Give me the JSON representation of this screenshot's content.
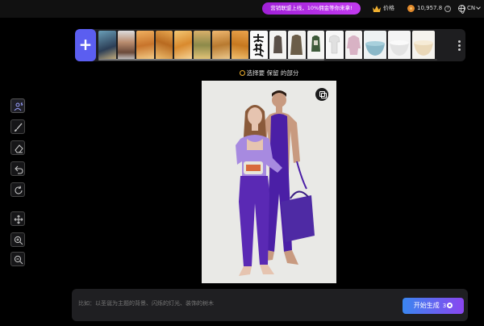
{
  "topbar": {
    "promo_text": "营销联盟上线，10%佣金等你来拿!",
    "price_label": "价格",
    "credits": "10,957.8",
    "help_symbol": "?",
    "language": "CN"
  },
  "strip": {
    "add_label": "+"
  },
  "hint": {
    "text": "选择要 保留 的部分"
  },
  "prompt": {
    "placeholder": "比如：以圣诞为主题的背景、闪烁的灯光、装饰的树木",
    "value": ""
  },
  "generate": {
    "label": "开始生成",
    "cost": "3"
  },
  "colors": {
    "accent": "#5b5ef0",
    "promo": "#b02ee0",
    "button_gradient_start": "#3a86f0",
    "button_gradient_end": "#8a46f0"
  }
}
